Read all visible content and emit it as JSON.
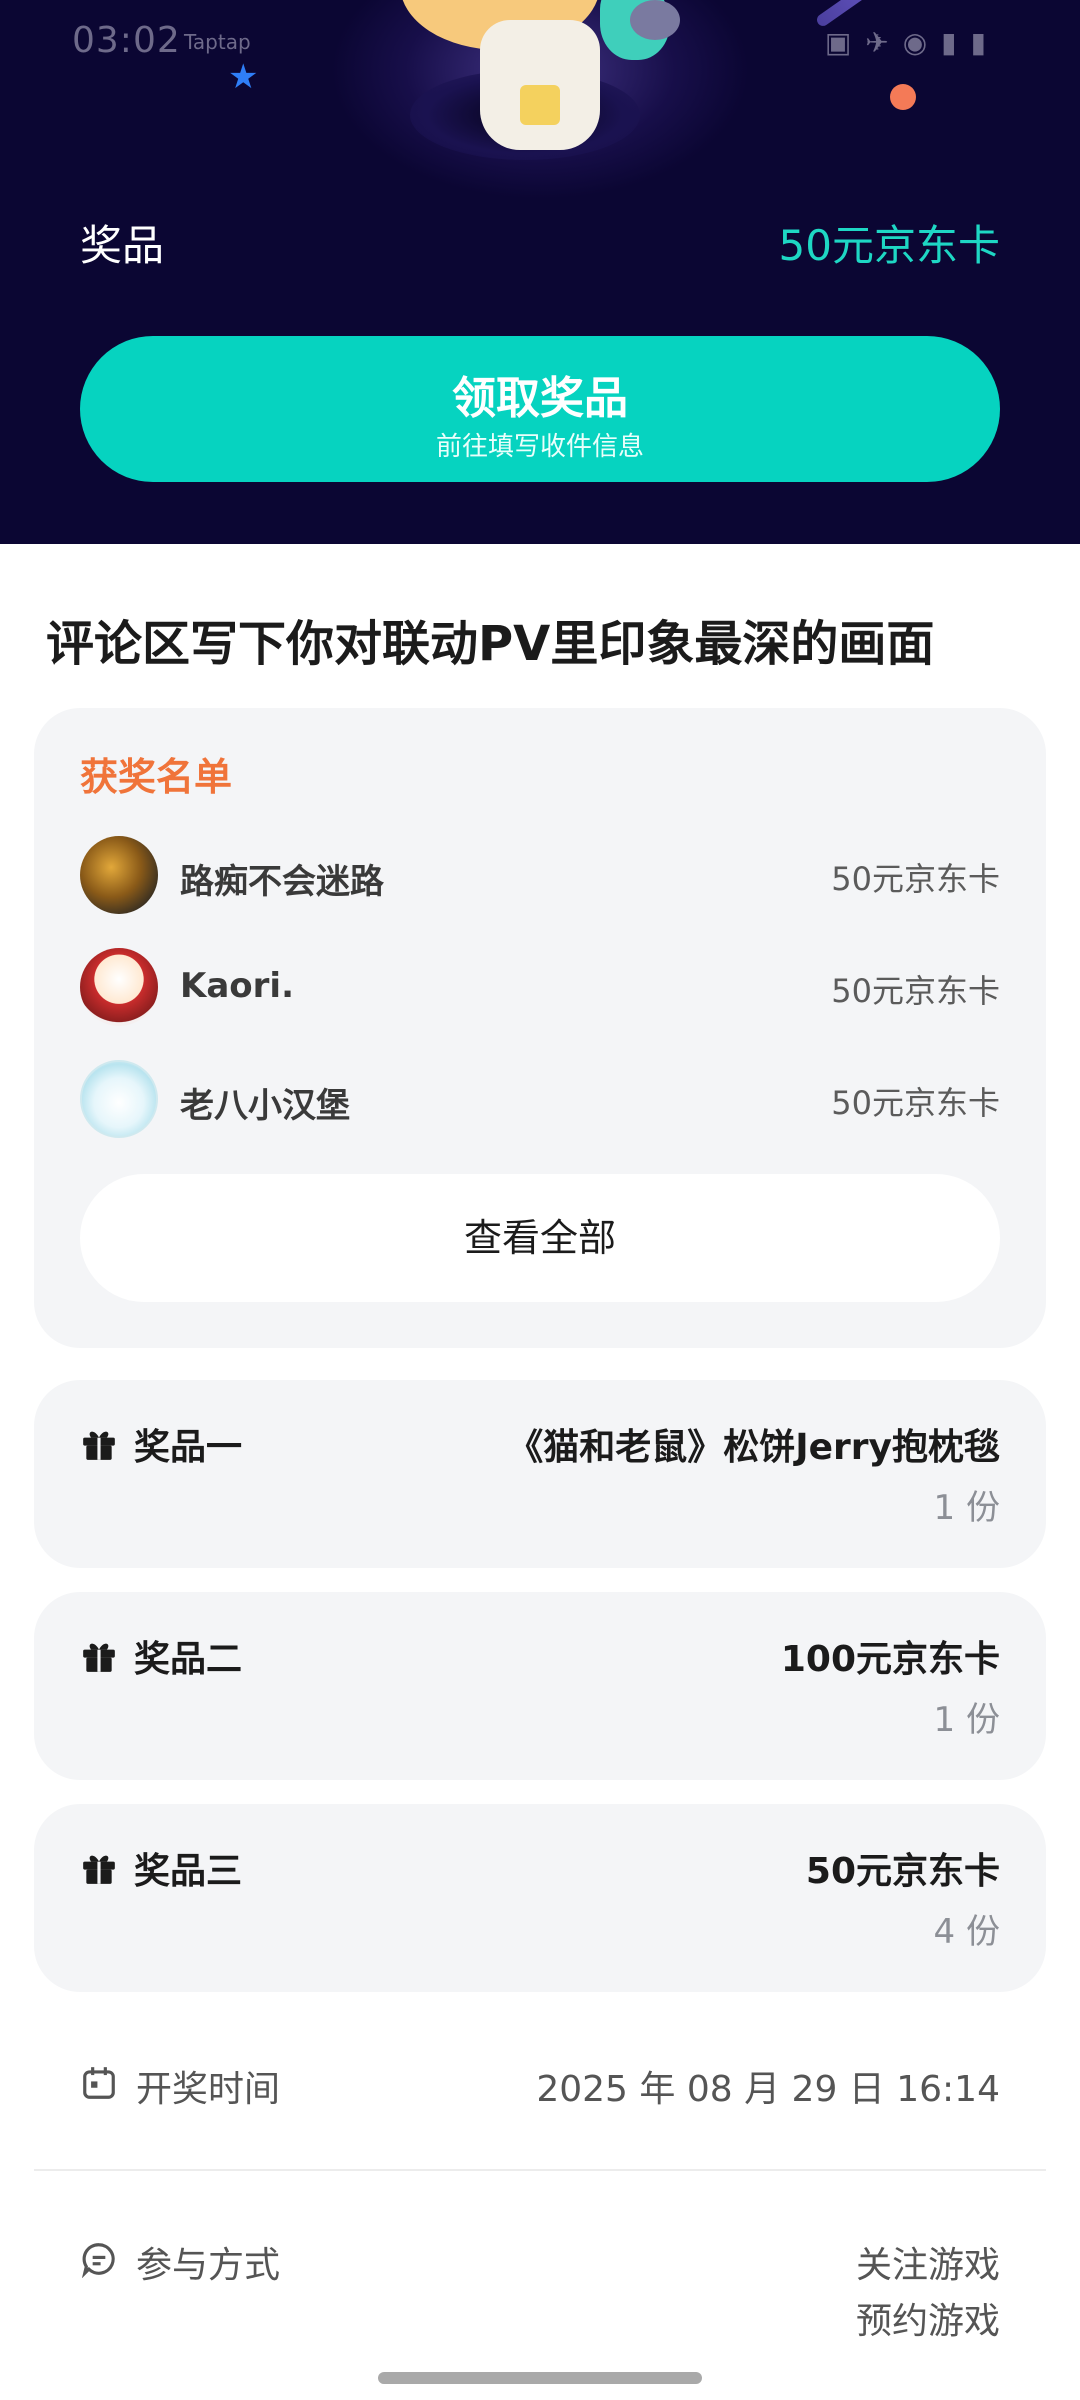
{
  "status_bar": {
    "time": "03:02",
    "extra": "Taptap"
  },
  "header": {
    "prize_label": "奖品",
    "prize_value": "50元京东卡",
    "claim_button": {
      "label": "领取奖品",
      "sublabel": "前往填写收件信息"
    }
  },
  "event": {
    "title": "评论区写下你对联动PV里印象最深的画面"
  },
  "winners": {
    "title": "获奖名单",
    "list": [
      {
        "name": "路痴不会迷路",
        "prize": "50元京东卡"
      },
      {
        "name": "Kaori.",
        "prize": "50元京东卡"
      },
      {
        "name": "老八小汉堡",
        "prize": "50元京东卡"
      }
    ],
    "view_all_label": "查看全部"
  },
  "prizes": [
    {
      "title": "奖品一",
      "name": "《猫和老鼠》松饼Jerry抱枕毯",
      "quantity": "1 份"
    },
    {
      "title": "奖品二",
      "name": "100元京东卡",
      "quantity": "1 份"
    },
    {
      "title": "奖品三",
      "name": "50元京东卡",
      "quantity": "4 份"
    }
  ],
  "draw_time": {
    "label": "开奖时间",
    "value": "2025 年 08 月 29 日 16:14"
  },
  "participation": {
    "label": "参与方式",
    "methods": [
      "关注游戏",
      "预约游戏"
    ]
  },
  "colors": {
    "accent": "#06d3c0",
    "header_bg": "#0b0633",
    "winners_title": "#f0743a",
    "card_bg": "#f4f5f7"
  }
}
